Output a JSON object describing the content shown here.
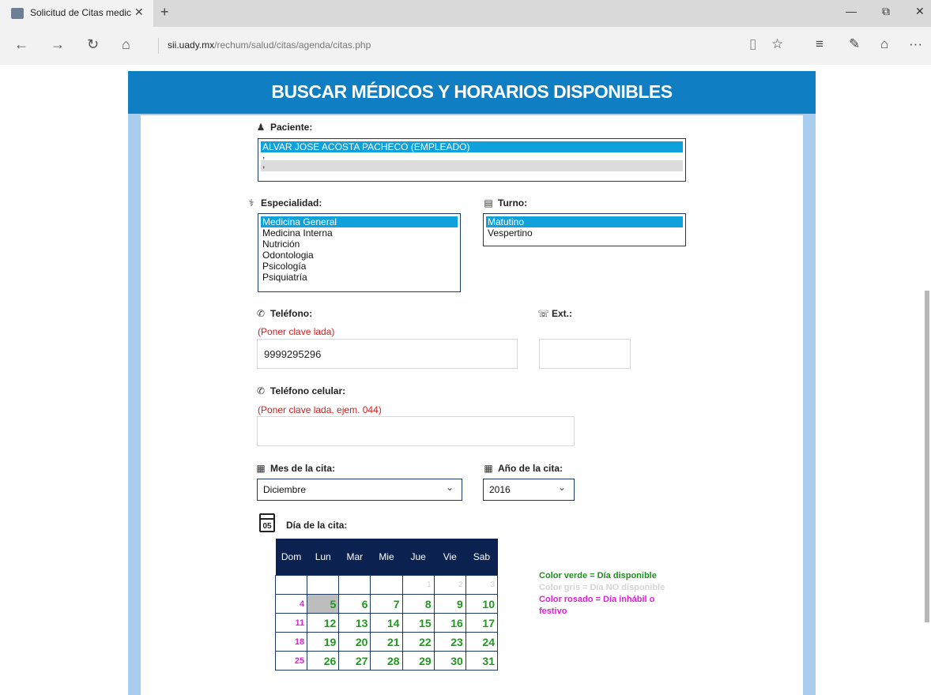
{
  "browser": {
    "tab_title": "Solicitud de Citas medic",
    "tab_close": "✕",
    "new_tab": "+",
    "url_host": "sii.uady.mx",
    "url_path": "/rechum/salud/citas/agenda/citas.php",
    "win_minimize": "—",
    "win_restore": "⧉",
    "win_close": "✕",
    "back_icon": "←",
    "forward_icon": "→",
    "refresh_icon": "↻",
    "home_icon": "⌂",
    "reading_icon": "▯",
    "star_icon": "☆",
    "hub_icon": "≡",
    "note_icon": "✎",
    "share_icon": "⌂",
    "more_icon": "···"
  },
  "header": {
    "title": "BUSCAR MÉDICOS Y HORARIOS DISPONIBLES"
  },
  "paciente": {
    "label": "Paciente:",
    "options": [
      "ALVAR JOSE ACOSTA PACHECO (EMPLEADO)",
      ",",
      ","
    ]
  },
  "especialidad": {
    "label": "Especialidad:",
    "options": [
      "Medicina General",
      "Medicina Interna",
      "Nutrición",
      "Odontologia",
      "Psicología",
      "Psiquiatría"
    ]
  },
  "turno": {
    "label": "Turno:",
    "options": [
      "Matutino",
      "Vespertino"
    ]
  },
  "telefono": {
    "label": "Teléfono:",
    "hint": "(Poner clave lada)",
    "value": "9999295296"
  },
  "ext": {
    "label": "Ext.:",
    "value": ""
  },
  "celular": {
    "label": "Teléfono celular:",
    "hint": "(Poner clave lada, ejem. 044)",
    "value": ""
  },
  "mes": {
    "label": "Mes de la cita:",
    "value": "Diciembre"
  },
  "anio": {
    "label": "Año de la cita:",
    "value": "2016"
  },
  "dia": {
    "label": "Día de la cita:",
    "icon_text": "05"
  },
  "calendar": {
    "headers": [
      "Dom",
      "Lun",
      "Mar",
      "Mie",
      "Jue",
      "Vie",
      "Sab"
    ],
    "rows": [
      [
        "",
        "",
        "",
        "",
        "1",
        "2",
        "3"
      ],
      [
        "4",
        "5",
        "6",
        "7",
        "8",
        "9",
        "10"
      ],
      [
        "11",
        "12",
        "13",
        "14",
        "15",
        "16",
        "17"
      ],
      [
        "18",
        "19",
        "20",
        "21",
        "22",
        "23",
        "24"
      ],
      [
        "25",
        "26",
        "27",
        "28",
        "29",
        "30",
        "31"
      ]
    ]
  },
  "legend": {
    "green": "Color verde = Día disponible",
    "gray": "Color gris = Día NO disponible",
    "pink1": "Color rosado = Día inhábil o",
    "pink2": "festivo"
  },
  "colors": {
    "header_blue": "#0f7ec2",
    "frame_light_blue": "#a9cdee",
    "selected_option": "#0ea1dc",
    "calendar_header": "#0b2251",
    "available_green": "#1e9a1e",
    "holiday_pink": "#e21fd8",
    "hint_red": "#d11e1e"
  }
}
